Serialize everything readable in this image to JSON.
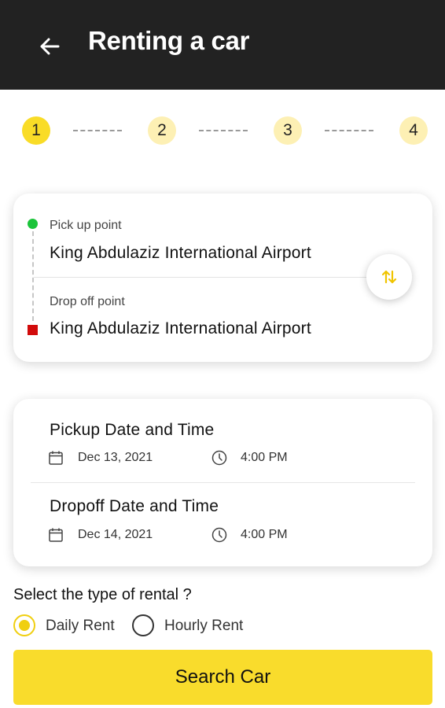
{
  "appbar": {
    "title": "Renting a car",
    "back_icon": "arrow-left-icon",
    "background": "#222222"
  },
  "stepper": {
    "steps": [
      "1",
      "2",
      "3",
      "4"
    ],
    "current": 1,
    "active_color": "#f9dc27",
    "inactive_color": "#fdf0b4"
  },
  "locations": {
    "pickup_label": "Pick up point",
    "pickup_value": "King Abdulaziz International Airport",
    "dropoff_label": "Drop off point",
    "dropoff_value": "King Abdulaziz International Airport",
    "swap_icon": "swap-vertical-icon",
    "pickup_marker_color": "#1bc43a",
    "dropoff_marker_color": "#d20b0b"
  },
  "dates": {
    "pickup_title": "Pickup Date and Time",
    "pickup_date": "Dec 13, 2021",
    "pickup_time": "4:00 PM",
    "dropoff_title": "Dropoff Date and Time",
    "dropoff_date": "Dec 14, 2021",
    "dropoff_time": "4:00 PM",
    "date_icon": "calendar-icon",
    "time_icon": "clock-icon"
  },
  "rental": {
    "question": "Select the type of rental ?",
    "options": [
      "Daily Rent",
      "Hourly Rent"
    ],
    "selected": "Daily Rent"
  },
  "search_button": {
    "label": "Search Car",
    "color": "#f9dc2c"
  }
}
